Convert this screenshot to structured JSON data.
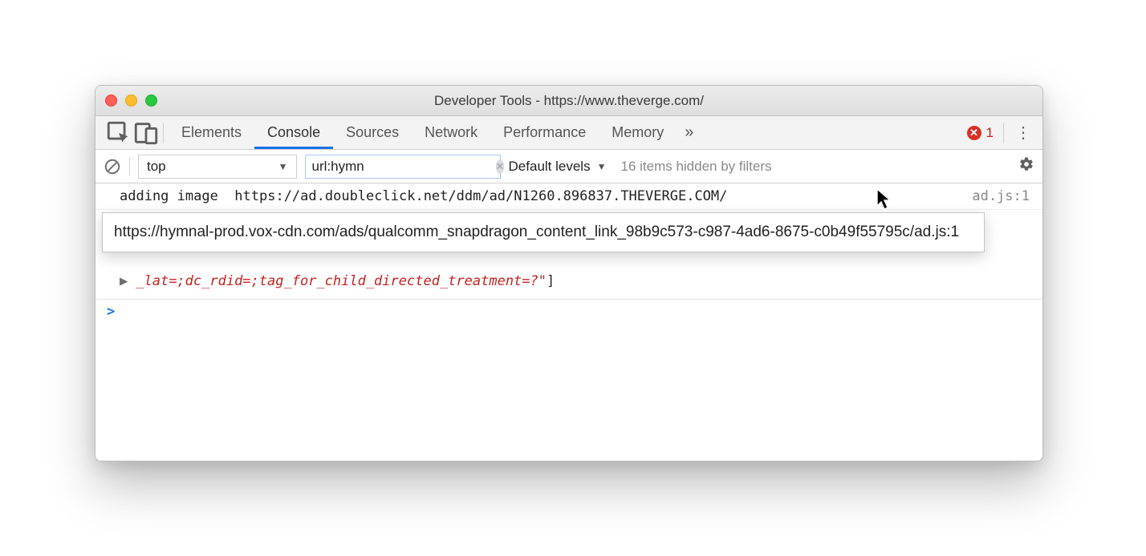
{
  "window": {
    "title": "Developer Tools - https://www.theverge.com/"
  },
  "tabs": {
    "items": [
      "Elements",
      "Console",
      "Sources",
      "Network",
      "Performance",
      "Memory"
    ],
    "active_index": 1,
    "overflow_glyph": "»",
    "error_count": "1"
  },
  "filter": {
    "context": "top",
    "filter_value": "url:hymn",
    "levels": "Default levels",
    "hidden_msg": "16 items hidden by filters"
  },
  "log": {
    "row0_msg": "adding image  https://ad.doubleclick.net/ddm/ad/N1260.896837.THEVERGE.COM/",
    "row0_src": "ad.js:1",
    "tooltip": "https://hymnal-prod.vox-cdn.com/ads/qualcomm_snapdragon_content_link_98b9c573-c987-4ad6-8675-c0b49f55795c/ad.js:1",
    "row1_tail": "_lat=;dc_rdid=;tag_for_child_directed_treatment=?\"",
    "row1_close": "]",
    "prompt": ">"
  }
}
